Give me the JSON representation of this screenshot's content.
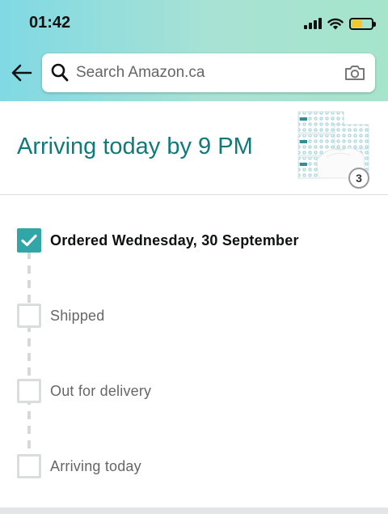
{
  "status_bar": {
    "time": "01:42"
  },
  "search": {
    "placeholder": "Search Amazon.ca"
  },
  "arrival": {
    "title": "Arriving today by 9 PM",
    "quantity": "3"
  },
  "tracker": {
    "steps": [
      {
        "label": "Ordered Wednesday, 30 September",
        "completed": true
      },
      {
        "label": "Shipped",
        "completed": false
      },
      {
        "label": "Out for delivery",
        "completed": false
      },
      {
        "label": "Arriving today",
        "completed": false
      }
    ]
  },
  "colors": {
    "accent": "#32A5A6",
    "title_teal": "#117A78",
    "battery": "#F7C72A"
  }
}
